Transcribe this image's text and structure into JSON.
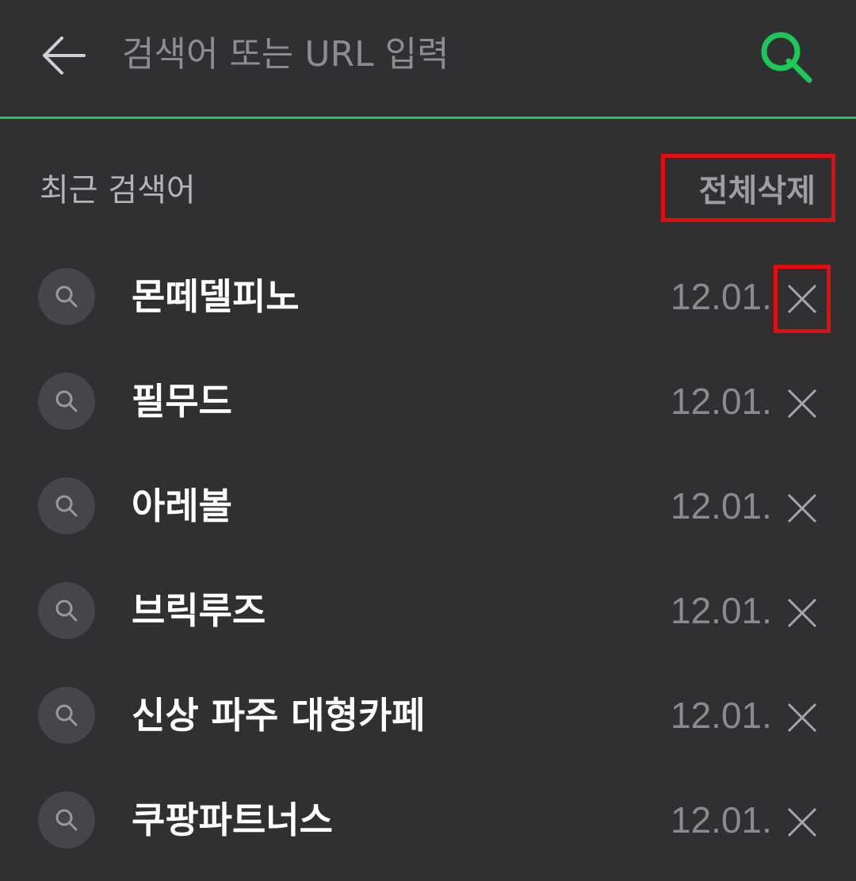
{
  "colors": {
    "accent": "#1ec75a",
    "highlight_box": "#e50b12",
    "background": "#303033"
  },
  "search": {
    "placeholder": "검색어 또는 URL 입력",
    "back_icon": "arrow-left-icon",
    "submit_icon": "search-icon"
  },
  "recent": {
    "title": "최근 검색어",
    "clear_all_label": "전체삭제",
    "items": [
      {
        "term": "몬떼델피노",
        "date": "12.01."
      },
      {
        "term": "필무드",
        "date": "12.01."
      },
      {
        "term": "아레볼",
        "date": "12.01."
      },
      {
        "term": "브릭루즈",
        "date": "12.01."
      },
      {
        "term": "신상 파주 대형카페",
        "date": "12.01."
      },
      {
        "term": "쿠팡파트너스",
        "date": "12.01."
      }
    ]
  }
}
